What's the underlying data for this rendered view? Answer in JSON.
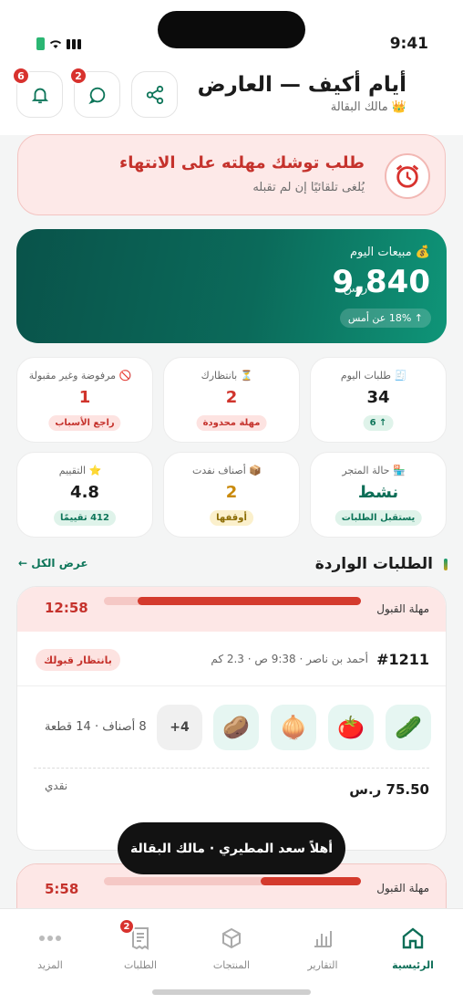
{
  "status_bar": {
    "time": "9:41"
  },
  "header": {
    "title": "أيام أكيف — العارض",
    "subtitle": "👑 مالك البقالة",
    "notifications_badge": "6",
    "messages_badge": "2"
  },
  "alert": {
    "title": "طلب توشك مهلته على الانتهاء",
    "subtitle": "يُلغى تلقائيًا إن لم تقبله"
  },
  "sales": {
    "label": "💰 مبيعات اليوم",
    "value": "9,840",
    "currency": "ر.س",
    "delta": "↑ 18% عن أمس"
  },
  "stats": [
    {
      "label": "🧾 طلبات اليوم",
      "value": "34",
      "pill": "↑ 6"
    },
    {
      "label": "⏳ بانتظارك",
      "value": "2",
      "pill": "مهلة محدودة"
    },
    {
      "label": "🚫 مرفوضة وغير مقبولة",
      "value": "1",
      "pill": "راجع الأسباب"
    },
    {
      "label": "🏪 حالة المتجر",
      "value": "نشط",
      "pill": "يستقبل الطلبات"
    },
    {
      "label": "📦 أصناف نفدت",
      "value": "2",
      "pill": "أوقفها"
    },
    {
      "label": "⭐ التقييم",
      "value": "4.8",
      "pill": "412 تقييمًا"
    }
  ],
  "orders_section": {
    "title": "الطلبات الواردة",
    "view_all": "عرض الكل ←"
  },
  "order": {
    "deadline_label": "مهلة القبول",
    "timer": "12:58",
    "deadline_progress": 0.87,
    "id": "#1211",
    "meta": "أحمد بن ناصر · 9:38 ص · 2.3 كم",
    "status": "بانتظار قبولك",
    "items": [
      "🥒",
      "🍅",
      "🧅",
      "🥔"
    ],
    "more": "+4",
    "count": "8 أصناف · 14 قطعة",
    "price": "75.50 ر.س",
    "payment": "نقدي"
  },
  "order2": {
    "deadline_label": "مهلة القبول",
    "timer": "5:58",
    "deadline_progress": 0.39
  },
  "toast": "أهلاً سعد المطيري · مالك البقالة",
  "tabs": [
    {
      "label": "الرئيسية",
      "icon": "home-icon",
      "active": true
    },
    {
      "label": "التقارير",
      "icon": "reports-icon"
    },
    {
      "label": "المنتجات",
      "icon": "box-icon"
    },
    {
      "label": "الطلبات",
      "icon": "receipt-icon",
      "badge": "2"
    },
    {
      "label": "المزيد",
      "icon": "more-icon"
    }
  ],
  "colors": {
    "brand_green": "#0d6e57",
    "alert_red": "#c5322c"
  }
}
